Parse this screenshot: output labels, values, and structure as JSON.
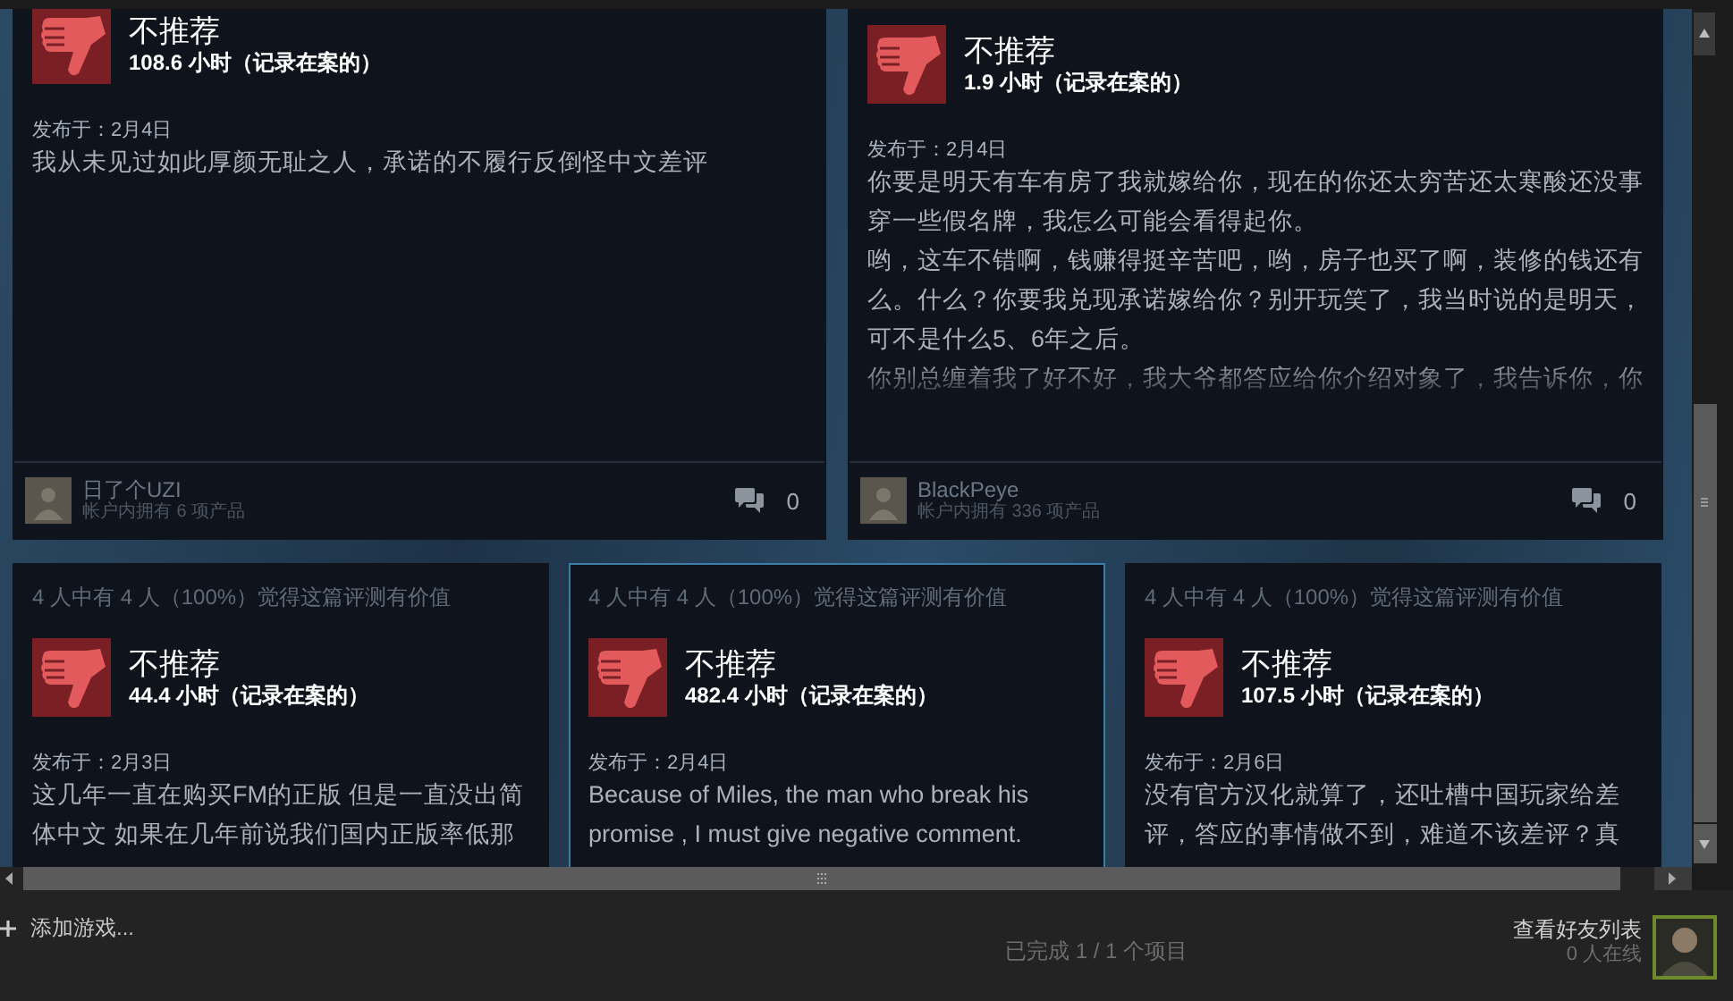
{
  "reviews": [
    {
      "verdict": "不推荐",
      "hours": "108.6 小时（记录在案的）",
      "posted": "发布于：2月4日",
      "body": [
        "我从未见过如此厚颜无耻之人，承诺的不履行反倒怪中文差评"
      ],
      "author": {
        "name": "日了个UZI",
        "products": "帐户内拥有 6 项产品"
      },
      "comments": "0",
      "selected": false
    },
    {
      "verdict": "不推荐",
      "hours": "1.9 小时（记录在案的）",
      "posted": "发布于：2月4日",
      "body": [
        "你要是明天有车有房了我就嫁给你，现在的你还太穷苦还太寒酸还没事穿一些假名牌，我怎么可能会看得起你。",
        "哟，这车不错啊，钱赚得挺辛苦吧，哟，房子也买了啊，装修的钱还有么。什么？你要我兑现承诺嫁给你？别开玩笑了，我当时说的是明天，可不是什么5、6年之后。",
        "你别总缠着我了好不好，我大爷都答应给你介绍对象了，我告诉你，你"
      ],
      "faded": true,
      "author": {
        "name": "BlackPeye",
        "products": "帐户内拥有 336 项产品"
      },
      "comments": "0",
      "selected": false
    },
    {
      "helpful": "4 人中有 4 人（100%）觉得这篇评测有价值",
      "verdict": "不推荐",
      "hours": "44.4 小时（记录在案的）",
      "posted": "发布于：2月3日",
      "body": [
        "这几年一直在购买FM的正版 但是一直没出简体中文 如果在几年前说我们国内正版率低那"
      ],
      "selected": false
    },
    {
      "helpful": "4 人中有 4 人（100%）觉得这篇评测有价值",
      "verdict": "不推荐",
      "hours": "482.4 小时（记录在案的）",
      "posted": "发布于：2月4日",
      "body": [
        "Because of Miles, the man who break his promise , I must give negative comment."
      ],
      "selected": true
    },
    {
      "helpful": "4 人中有 4 人（100%）觉得这篇评测有价值",
      "verdict": "不推荐",
      "hours": "107.5 小时（记录在案的）",
      "posted": "发布于：2月6日",
      "body": [
        "没有官方汉化就算了，还吐槽中国玩家给差评，答应的事情做不到，难道不该差评？真"
      ],
      "selected": false
    }
  ],
  "footer": {
    "add_game": "添加游戏...",
    "status": "已完成 1 / 1 个项目",
    "friends": "查看好友列表",
    "online": "0 人在线"
  }
}
